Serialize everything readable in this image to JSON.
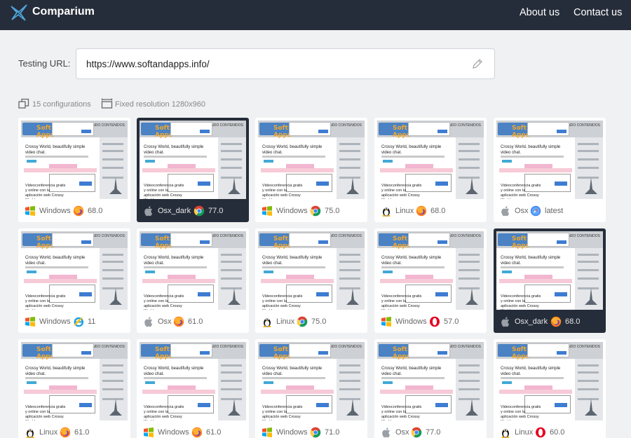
{
  "header": {
    "brand": "Comparium",
    "nav": [
      {
        "label": "About us"
      },
      {
        "label": "Contact us"
      }
    ]
  },
  "testing": {
    "label": "Testing URL:",
    "url": "https://www.softandapps.info/"
  },
  "summary": {
    "configurations": "15 configurations",
    "resolution": "Fixed resolution 1280x960"
  },
  "thumbnail": {
    "logo": "Soft & Apps",
    "header_right": "OFRECIENDO CONTENIDOS",
    "headline": "Crossy World, beautifully simple video chat.",
    "caption": "Videoconferencia gratis y online con la aplicación web Crossy World"
  },
  "configs": [
    {
      "os": "Windows",
      "os_icon": "windows-icon",
      "browser": "firefox-icon",
      "version": "68.0",
      "selected": false
    },
    {
      "os": "Osx_dark",
      "os_icon": "apple-icon",
      "browser": "chrome-icon",
      "version": "77.0",
      "selected": true
    },
    {
      "os": "Windows",
      "os_icon": "windows-icon",
      "browser": "chrome-icon",
      "version": "75.0",
      "selected": false
    },
    {
      "os": "Linux",
      "os_icon": "linux-icon",
      "browser": "firefox-icon",
      "version": "68.0",
      "selected": false
    },
    {
      "os": "Osx",
      "os_icon": "apple-icon",
      "browser": "safari-icon",
      "version": "latest",
      "selected": false
    },
    {
      "os": "Windows",
      "os_icon": "windows-icon",
      "browser": "ie-icon",
      "version": "11",
      "selected": false
    },
    {
      "os": "Osx",
      "os_icon": "apple-icon",
      "browser": "firefox-icon",
      "version": "61.0",
      "selected": false
    },
    {
      "os": "Linux",
      "os_icon": "linux-icon",
      "browser": "chrome-icon",
      "version": "75.0",
      "selected": false
    },
    {
      "os": "Windows",
      "os_icon": "windows-icon",
      "browser": "opera-icon",
      "version": "57.0",
      "selected": false
    },
    {
      "os": "Osx_dark",
      "os_icon": "apple-icon",
      "browser": "firefox-icon",
      "version": "68.0",
      "selected": true
    },
    {
      "os": "Linux",
      "os_icon": "linux-icon",
      "browser": "firefox-icon",
      "version": "61.0",
      "selected": false
    },
    {
      "os": "Windows",
      "os_icon": "windows-icon",
      "browser": "firefox-icon",
      "version": "61.0",
      "selected": false
    },
    {
      "os": "Windows",
      "os_icon": "windows-icon",
      "browser": "chrome-icon",
      "version": "71.0",
      "selected": false
    },
    {
      "os": "Osx",
      "os_icon": "apple-icon",
      "browser": "chrome-icon",
      "version": "77.0",
      "selected": false
    },
    {
      "os": "Linux",
      "os_icon": "linux-icon",
      "browser": "opera-icon",
      "version": "60.0",
      "selected": false
    }
  ],
  "colors": {
    "topbar": "#262d3a",
    "selected_card": "#262d3a",
    "page_bg": "#f0f1f2"
  }
}
